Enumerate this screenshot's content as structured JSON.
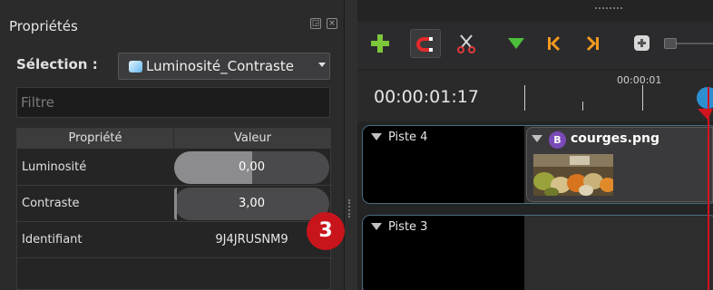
{
  "properties_panel": {
    "title": "Propriétés",
    "selection_label": "Sélection :",
    "selection_value": "Luminosité_Contraste",
    "filter_placeholder": "Filtre",
    "columns": [
      "Propriété",
      "Valeur"
    ],
    "rows": [
      {
        "name": "Luminosité",
        "value": "0,00",
        "level": 0.5
      },
      {
        "name": "Contraste",
        "value": "3,00",
        "level": 0.02
      },
      {
        "name": "Identifiant",
        "value": "9J4JRUSNM9"
      }
    ]
  },
  "annotation": {
    "step": "3",
    "color": "#c8141b"
  },
  "timeline": {
    "toolbar": [
      "add-icon",
      "magnet-icon",
      "razor-icon",
      "marker-icon",
      "jump-start-icon",
      "jump-end-icon",
      "zoom-icon"
    ],
    "timecode": "00:00:01:17",
    "ruler_label": "00:00:01",
    "tracks": [
      {
        "name": "Piste 4"
      },
      {
        "name": "Piste 3"
      }
    ],
    "clip": {
      "badge": "B",
      "name": "courges.png"
    },
    "playhead_color": "#d2141e"
  }
}
